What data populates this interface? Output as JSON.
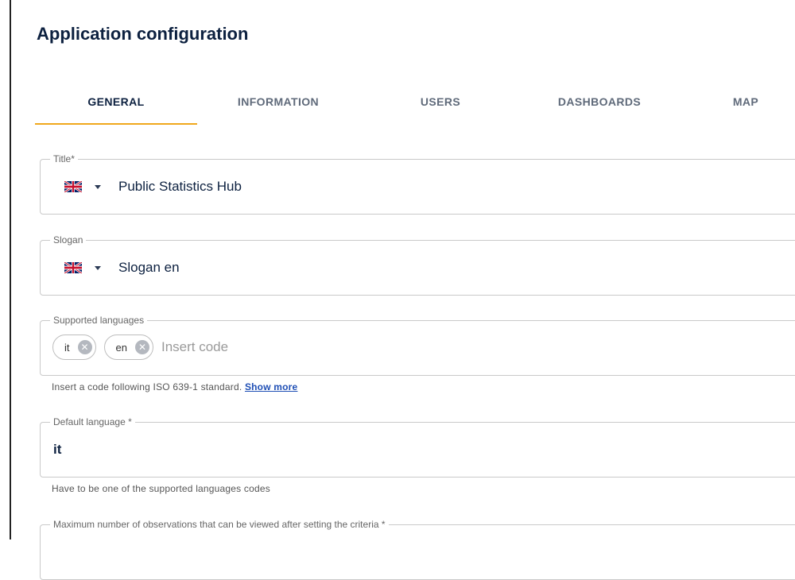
{
  "page": {
    "title": "Application configuration"
  },
  "tabs": [
    {
      "label": "GENERAL",
      "active": true
    },
    {
      "label": "INFORMATION",
      "active": false
    },
    {
      "label": "USERS",
      "active": false
    },
    {
      "label": "DASHBOARDS",
      "active": false
    },
    {
      "label": "MAP",
      "active": false
    }
  ],
  "accent_color": "#f0a81c",
  "form": {
    "title_field": {
      "label": "Title*",
      "language_icon": "uk-flag-icon",
      "value": "Public Statistics Hub"
    },
    "slogan_field": {
      "label": "Slogan",
      "language_icon": "uk-flag-icon",
      "value": "Slogan en"
    },
    "supported_languages": {
      "label": "Supported languages",
      "chips": [
        {
          "label": "it"
        },
        {
          "label": "en"
        }
      ],
      "placeholder": "Insert code",
      "helper": "Insert a code following ISO 639-1 standard.",
      "helper_link": "Show more"
    },
    "default_language": {
      "label": "Default language *",
      "value": "it",
      "helper": "Have to be one of the supported languages codes"
    },
    "max_observations": {
      "label": "Maximum number of observations that can be viewed after setting the criteria *"
    }
  }
}
